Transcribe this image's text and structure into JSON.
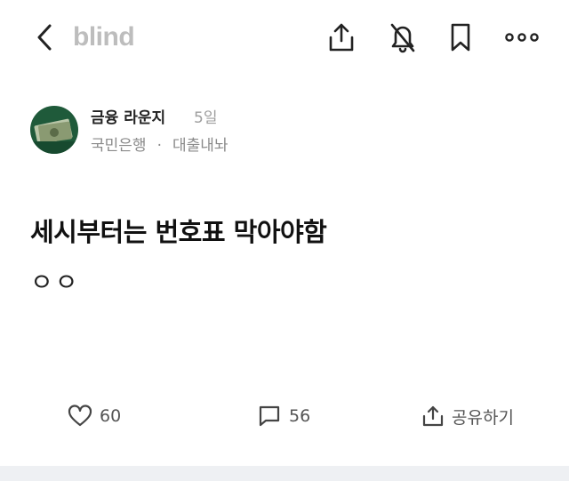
{
  "header": {
    "back_icon": "chevron-left-icon",
    "logo": "blind",
    "actions": [
      "share-icon",
      "notification-off-icon",
      "bookmark-icon",
      "more-icon"
    ]
  },
  "post": {
    "author": {
      "name": "금융 라운지",
      "time": "5일",
      "company": "국민은행",
      "separator": "·",
      "board": "대출내놔"
    },
    "title": "세시부터는 번호표 막아야함",
    "body": "ㅇㅇ"
  },
  "footer": {
    "likes": "60",
    "comments": "56",
    "share_label": "공유하기"
  },
  "colors": {
    "logo": "#bdbdbd",
    "meta": "#8a8a8a",
    "bottom_band": "#eef0f3"
  }
}
